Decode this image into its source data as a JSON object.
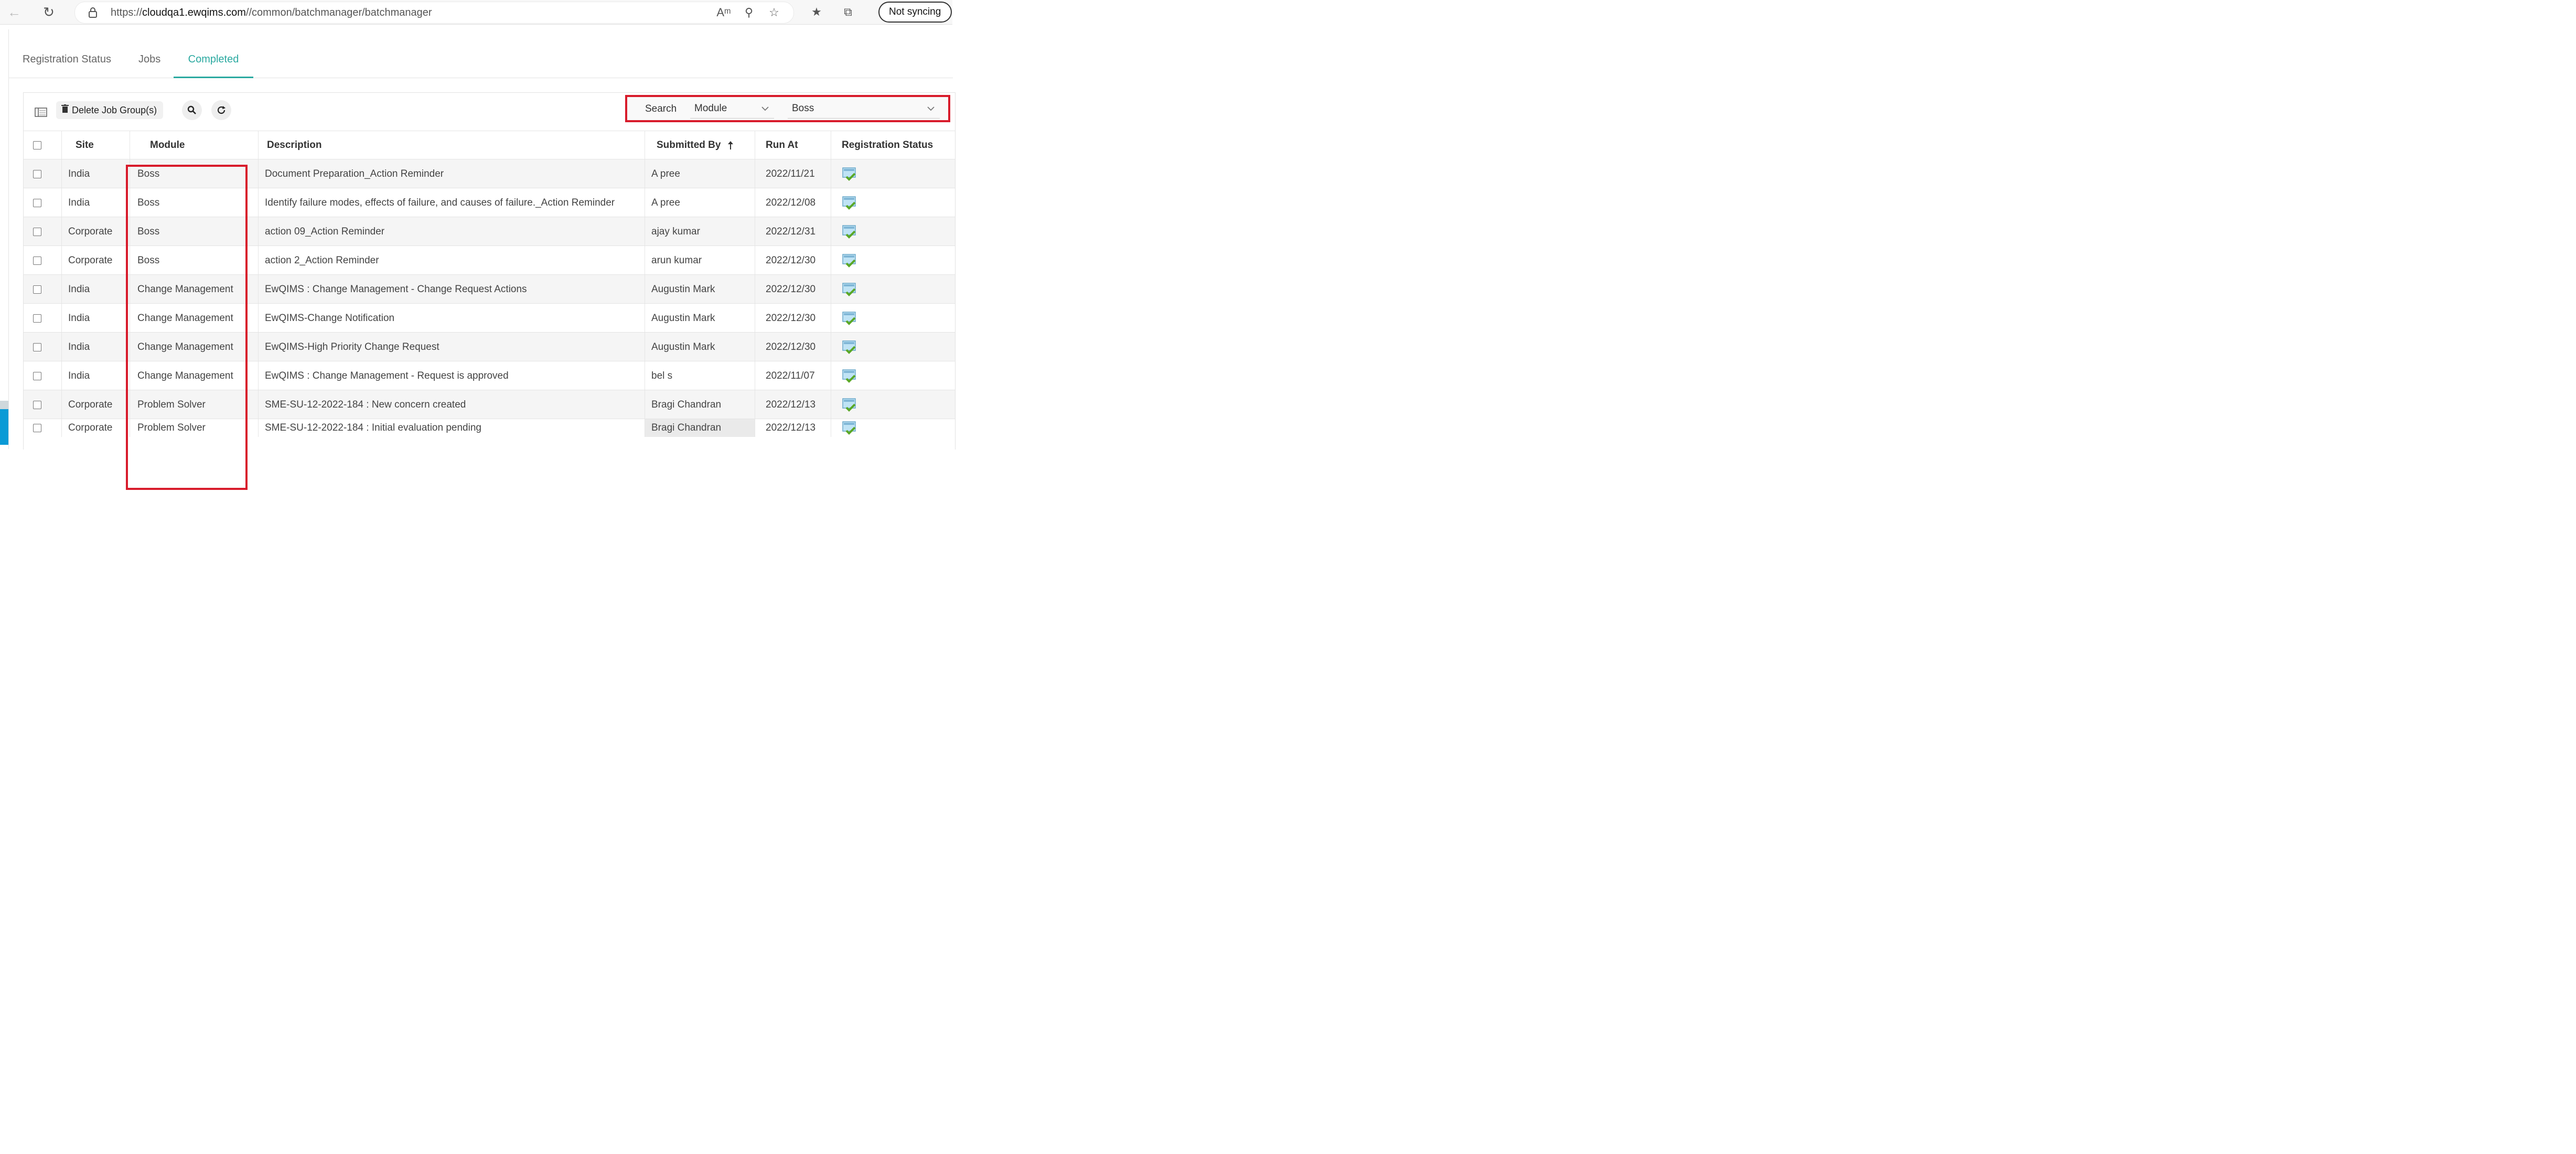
{
  "browser": {
    "url_prefix": "https://",
    "url_host": "cloudqa1.ewqims.com",
    "url_path": "//common/batchmanager/batchmanager",
    "profile_status": "Not syncing"
  },
  "tabs": [
    {
      "label": "Registration Status",
      "active": false
    },
    {
      "label": "Jobs",
      "active": false
    },
    {
      "label": "Completed",
      "active": true
    }
  ],
  "toolbar": {
    "delete_label": "Delete Job Group(s)",
    "search_label": "Search",
    "search_field_value": "Module",
    "search_value": "Boss"
  },
  "table": {
    "columns": [
      "Site",
      "Module",
      "Description",
      "Submitted By",
      "Run At",
      "Registration Status"
    ],
    "sorted_column": "Submitted By",
    "sort_direction": "ascending",
    "rows": [
      {
        "site": "India",
        "module": "Boss",
        "description": "Document Preparation_Action Reminder",
        "submitted_by": "A pree",
        "run_at": "2022/11/21"
      },
      {
        "site": "India",
        "module": "Boss",
        "description": "Identify failure modes, effects of failure, and causes of failure._Action Reminder",
        "submitted_by": "A pree",
        "run_at": "2022/12/08"
      },
      {
        "site": "Corporate",
        "module": "Boss",
        "description": "action 09_Action Reminder",
        "submitted_by": "ajay kumar",
        "run_at": "2022/12/31"
      },
      {
        "site": "Corporate",
        "module": "Boss",
        "description": "action 2_Action Reminder",
        "submitted_by": "arun kumar",
        "run_at": "2022/12/30"
      },
      {
        "site": "India",
        "module": "Change Management",
        "description": "EwQIMS : Change Management - Change Request Actions",
        "submitted_by": "Augustin Mark",
        "run_at": "2022/12/30"
      },
      {
        "site": "India",
        "module": "Change Management",
        "description": "EwQIMS-Change Notification",
        "submitted_by": "Augustin Mark",
        "run_at": "2022/12/30"
      },
      {
        "site": "India",
        "module": "Change Management",
        "description": "EwQIMS-High Priority Change Request",
        "submitted_by": "Augustin Mark",
        "run_at": "2022/12/30"
      },
      {
        "site": "India",
        "module": "Change Management",
        "description": "EwQIMS : Change Management - Request is approved",
        "submitted_by": "bel s",
        "run_at": "2022/11/07"
      },
      {
        "site": "Corporate",
        "module": "Problem Solver",
        "description": "SME-SU-12-2022-184 : New concern created",
        "submitted_by": "Bragi Chandran",
        "run_at": "2022/12/13"
      },
      {
        "site": "Corporate",
        "module": "Problem Solver",
        "description": "SME-SU-12-2022-184 : Initial evaluation pending",
        "submitted_by": "Bragi Chandran",
        "run_at": "2022/12/13"
      }
    ]
  },
  "icons": {
    "status_icon": "registration-complete-icon",
    "highlight_color": "#d81b2b",
    "accent_color": "#2aa9a0"
  }
}
